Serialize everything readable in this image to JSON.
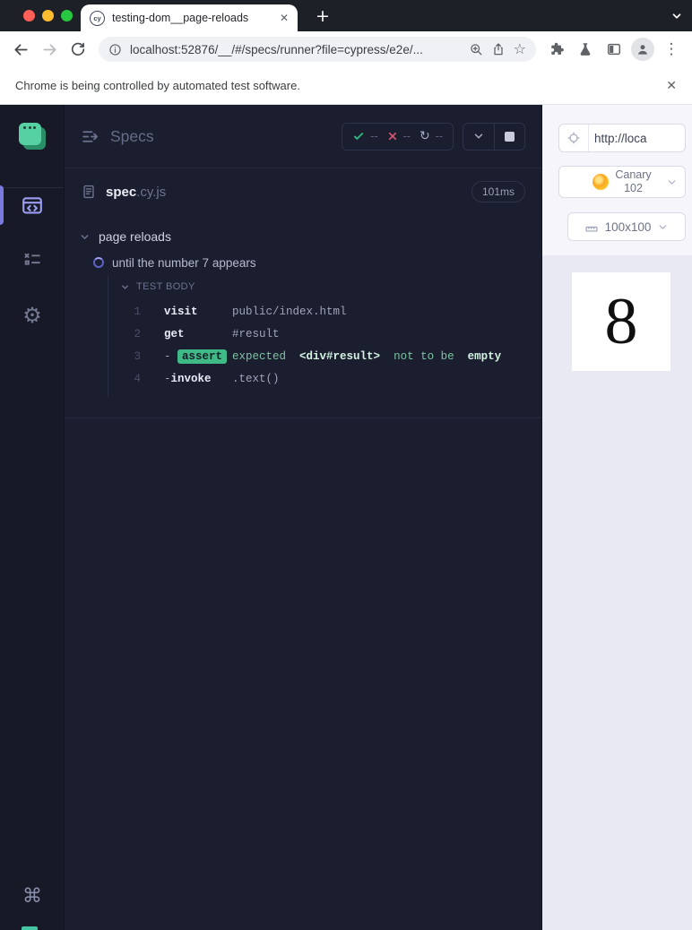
{
  "browser": {
    "tab_title": "testing-dom__page-reloads",
    "tab_favicon_label": "cy",
    "url": "localhost:52876/__/#/specs/runner?file=cypress/e2e/...",
    "infobar_text": "Chrome is being controlled by automated test software."
  },
  "icons": {
    "close": "✕",
    "plus": "+",
    "star": "☆",
    "refresh_circle": "↻",
    "menu_dots": "⋮",
    "gear": "⚙",
    "command_key": "⌘"
  },
  "reporter": {
    "title": "Specs",
    "stats": {
      "passed": "--",
      "failed": "--",
      "pending": "--"
    },
    "spec_name": "spec",
    "spec_ext": ".cy.js",
    "spec_duration": "101ms",
    "suite_title": "page reloads",
    "test_title": "until the number 7 appears",
    "section_title": "TEST BODY",
    "commands": {
      "c1": {
        "num": "1",
        "name": "visit",
        "arg": "public/index.html"
      },
      "c2": {
        "num": "2",
        "name": "get",
        "arg": "#result"
      },
      "c3": {
        "num": "3",
        "dash": "-",
        "badge": "assert",
        "msg_pre": "expected",
        "msg_strong1": "<div#result>",
        "msg_mid": "not to be",
        "msg_strong2": "empty"
      },
      "c4": {
        "num": "4",
        "dash": "-",
        "name": "invoke",
        "arg": ".text()"
      }
    }
  },
  "aut": {
    "url_value": "http://loca",
    "browser_name": "Canary",
    "browser_version": "102",
    "viewport": "100x100",
    "result_number": "8"
  },
  "colors": {
    "accent_purple": "#7a79e0",
    "jade": "#3fba86",
    "reporter_bg": "#1b1e2e",
    "sidebar_bg": "#171a26",
    "stage_bg": "#e8e9f3",
    "canary_yellow": "#fbc228"
  }
}
